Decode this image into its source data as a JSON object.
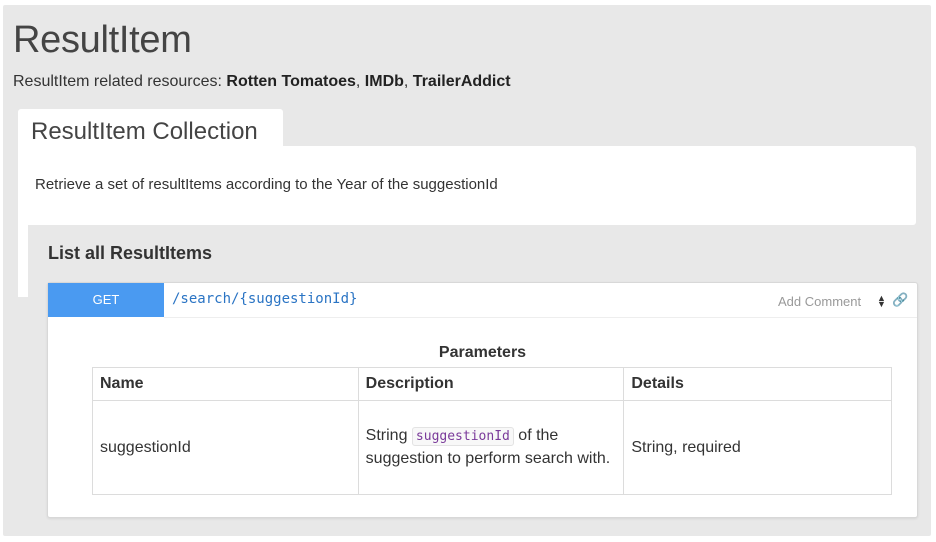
{
  "page": {
    "title": "ResultItem",
    "related_prefix": "ResultItem related resources: ",
    "related": [
      "Rotten Tomatoes",
      "IMDb",
      "TrailerAddict"
    ],
    "related_sep": ", "
  },
  "collection": {
    "tab_label": "ResultItem Collection",
    "description": "Retrieve a set of resultItems according to the Year of the suggestionId"
  },
  "action": {
    "title": "List all ResultItems",
    "method": "GET",
    "path": "/search/{suggestionId}",
    "add_comment": "Add Comment",
    "sort_icon": "sort-updown-icon",
    "link_icon": "link-icon",
    "method_color": "#4a9af1"
  },
  "parameters": {
    "title": "Parameters",
    "headers": [
      "Name",
      "Description",
      "Details"
    ],
    "rows": [
      {
        "name": "suggestionId",
        "desc_before": "String ",
        "desc_code": "suggestionId",
        "desc_after": " of the suggestion to perform search with.",
        "details": "String, required"
      }
    ]
  }
}
